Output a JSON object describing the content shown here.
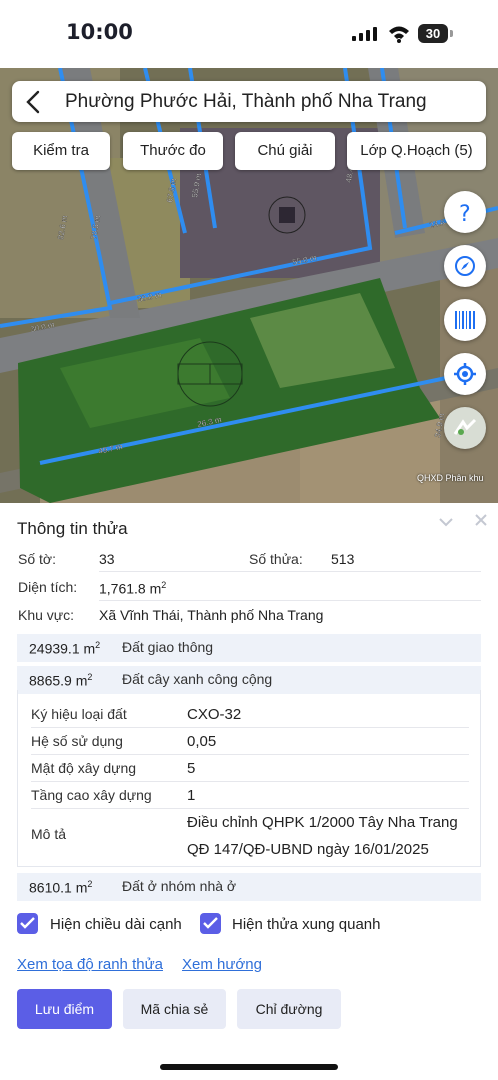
{
  "status_bar": {
    "time": "10:00",
    "battery": "30"
  },
  "search": {
    "title": "Phường Phước Hải, Thành phố Nha Trang"
  },
  "toolbar": {
    "check": "Kiểm tra",
    "measure": "Thước đo",
    "legend": "Chú giải",
    "layers": "Lớp Q.Hoạch (5)"
  },
  "map": {
    "attribution": "QHXD Phân khu",
    "edge_labels": [
      "55.0 m",
      "30.0 m",
      "30.0 m",
      "26.3 m",
      "49.7 m",
      "48.4 m",
      "55.9 m",
      "67.8 m",
      "78.5 m",
      "82.6 m",
      "24.6",
      "34.9 m"
    ]
  },
  "panel": {
    "title": "Thông tin thửa",
    "so_to_label": "Số tờ:",
    "so_to": "33",
    "so_thua_label": "Số thửa:",
    "so_thua": "513",
    "dien_tich_label": "Diện tích:",
    "dien_tich": "1,761.8 m",
    "dien_tich_unit": "2",
    "khu_vuc_label": "Khu vực:",
    "khu_vuc": "Xã Vĩnh Thái, Thành phố Nha Trang",
    "zones": [
      {
        "area": "24939.1 m",
        "unit": "2",
        "kind": "Đất giao thông"
      },
      {
        "area": "8865.9 m",
        "unit": "2",
        "kind": "Đất cây xanh công cộng"
      },
      {
        "area": "8610.1 m",
        "unit": "2",
        "kind": "Đất ở nhóm nhà ở"
      }
    ],
    "details": {
      "ky_hieu_label": "Ký hiệu loại đất",
      "ky_hieu": "CXO-32",
      "he_so_label": "Hệ số sử dụng",
      "he_so": "0,05",
      "mat_do_label": "Mật độ xây dựng",
      "mat_do": "5",
      "tang_cao_label": "Tầng cao xây dựng",
      "tang_cao": "1",
      "mo_ta_label": "Mô tả",
      "mo_ta_line1": "Điều chỉnh QHPK 1/2000 Tây Nha Trang",
      "mo_ta_line2": "QĐ 147/QĐ-UBND ngày 16/01/2025"
    },
    "checkboxes": {
      "edge_length": "Hiện chiều dài cạnh",
      "neighbors": "Hiện thửa xung quanh"
    },
    "links": {
      "coords": "Xem tọa độ ranh thửa",
      "direction": "Xem hướng"
    },
    "buttons": {
      "save": "Lưu điểm",
      "share": "Mã chia sẻ",
      "route": "Chỉ đường"
    }
  },
  "colors": {
    "accent": "#5b5ee6",
    "link": "#2f6fd9",
    "parcel_line": "#2f8df0"
  }
}
